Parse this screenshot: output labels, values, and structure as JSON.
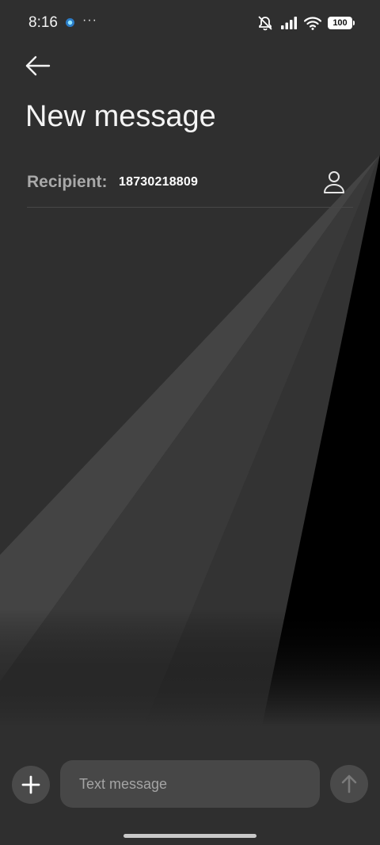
{
  "status_bar": {
    "time": "8:16",
    "more": "···",
    "battery": "100"
  },
  "header": {
    "title": "New message"
  },
  "recipient": {
    "label": "Recipient:",
    "value": "18730218809"
  },
  "composer": {
    "placeholder": "Text message"
  },
  "icons": {
    "back": "arrow-left-icon",
    "contact": "person-icon",
    "attach": "plus-icon",
    "send": "arrow-up-icon",
    "signal": "signal-icon",
    "wifi": "wifi-icon",
    "silent": "bell-off-icon"
  },
  "colors": {
    "background": "#2f2f2f",
    "field": "#474747",
    "label": "#a9a9a9"
  }
}
